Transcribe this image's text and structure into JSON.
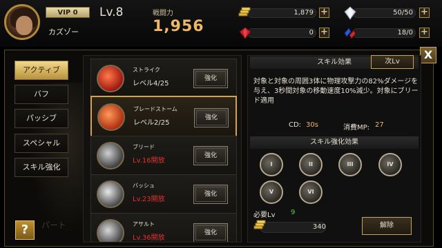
{
  "player": {
    "vip": "VIP 0",
    "level": "Lv.8",
    "name": "カズゾー",
    "combat_power_label": "戦闘力",
    "combat_power": "1,956"
  },
  "resources": {
    "gold": "1,879",
    "crystal": "50/50",
    "ruby": "0",
    "tickets": "18/0",
    "plus_label": "+"
  },
  "close_label": "X",
  "help_label": "?",
  "tabs": [
    {
      "label": "アクティブ",
      "active": true
    },
    {
      "label": "バフ",
      "active": false
    },
    {
      "label": "パッシブ",
      "active": false
    },
    {
      "label": "スペシャル",
      "active": false
    },
    {
      "label": "スキル強化",
      "active": false
    }
  ],
  "background_text": "パート",
  "skills": [
    {
      "name": "ストライク",
      "level": "レベル4/25",
      "button": "強化",
      "locked": false,
      "selected": false,
      "color": "#e03a20"
    },
    {
      "name": "ブレードストーム",
      "level": "レベル2/25",
      "button": "強化",
      "locked": false,
      "selected": true,
      "color": "#d84a1c"
    },
    {
      "name": "ブリード",
      "level": "Lv.16開放",
      "button": "強化",
      "locked": true,
      "selected": false,
      "color": "#9a9a9a"
    },
    {
      "name": "バッシュ",
      "level": "Lv.23開放",
      "button": "強化",
      "locked": true,
      "selected": false,
      "color": "#b0b0b0"
    },
    {
      "name": "アサルト",
      "level": "Lv.36開放",
      "button": "強化",
      "locked": true,
      "selected": false,
      "color": "#a0a0a0"
    }
  ],
  "detail": {
    "header": "スキル効果",
    "next_level_button": "次Lv",
    "description": "対象と対象の周囲3体に物理攻撃力の82%ダメージを与え、3秒間対象の移動速度10%減少。対象にブリード適用",
    "cd_label": "CD:",
    "cd_value": "30s",
    "mp_label": "消費MP:",
    "mp_value": "27",
    "enhance_header": "スキル強化効果",
    "enhancements": [
      "I",
      "II",
      "III",
      "IV",
      "V",
      "VI"
    ],
    "required_level_label": "必要Lv",
    "required_level": "9",
    "cost": "340",
    "unlock_button": "解除"
  },
  "colors": {
    "accent_gold": "#d7a24a",
    "cp_value": "#f0b864",
    "locked_red": "#e03232",
    "req_green": "#5fd04a"
  }
}
